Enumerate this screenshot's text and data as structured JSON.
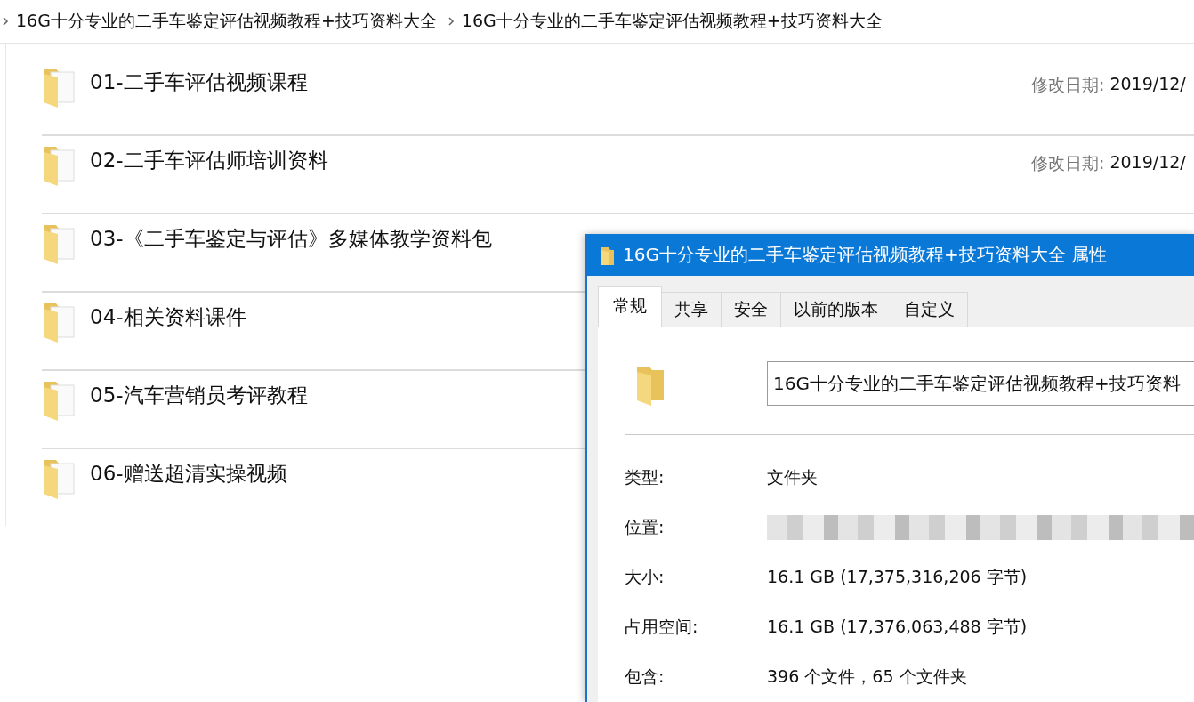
{
  "breadcrumb": [
    "16G十分专业的二手车鉴定评估视频教程+技巧资料大全",
    "16G十分专业的二手车鉴定评估视频教程+技巧资料大全"
  ],
  "folders": [
    {
      "name": "01-二手车评估视频课程",
      "date_label": "修改日期:",
      "date_value": "2019/12/"
    },
    {
      "name": "02-二手车评估师培训资料",
      "date_label": "修改日期:",
      "date_value": "2019/12/"
    },
    {
      "name": "03-《二手车鉴定与评估》多媒体教学资料包"
    },
    {
      "name": "04-相关资料课件"
    },
    {
      "name": "05-汽车营销员考评教程"
    },
    {
      "name": "06-赠送超清实操视频"
    }
  ],
  "dialog": {
    "title": "16G十分专业的二手车鉴定评估视频教程+技巧资料大全 属性",
    "tabs": [
      {
        "label": "常规",
        "selected": true
      },
      {
        "label": "共享",
        "selected": false
      },
      {
        "label": "安全",
        "selected": false
      },
      {
        "label": "以前的版本",
        "selected": false
      },
      {
        "label": "自定义",
        "selected": false
      }
    ],
    "name_value": "16G十分专业的二手车鉴定评估视频教程+技巧资料",
    "properties": [
      {
        "label": "类型:",
        "value": "文件夹",
        "kind": "text"
      },
      {
        "label": "位置:",
        "kind": "blurred"
      },
      {
        "label": "大小:",
        "value": "16.1 GB (17,375,316,206 字节)",
        "kind": "text"
      },
      {
        "label": "占用空间:",
        "value": "16.1 GB (17,376,063,488 字节)",
        "kind": "text"
      },
      {
        "label": "包含:",
        "value": "396 个文件，65 个文件夹",
        "kind": "text"
      }
    ]
  }
}
